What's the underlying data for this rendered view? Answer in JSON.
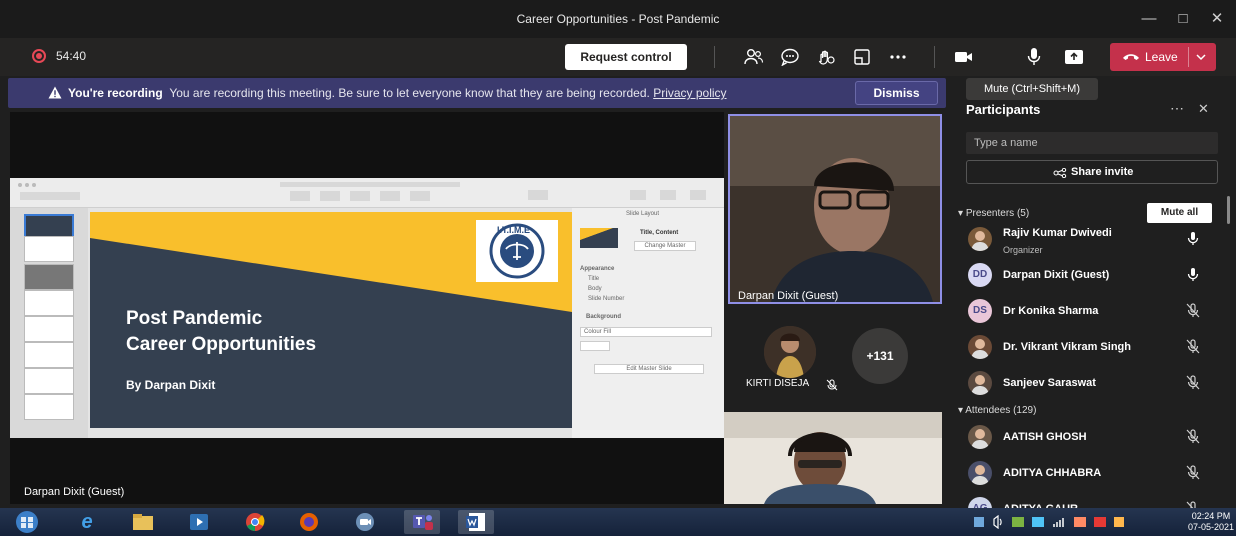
{
  "window": {
    "title": "Career Opportunities - Post Pandemic"
  },
  "toolbar": {
    "timer": "54:40",
    "request_control": "Request control",
    "leave": "Leave",
    "tooltip": "Mute (Ctrl+Shift+M)"
  },
  "banner": {
    "bold": "You're recording",
    "text": "You are recording this meeting. Be sure to let everyone know that they are being recorded.",
    "link": "Privacy policy",
    "dismiss": "Dismiss"
  },
  "shared_screen": {
    "presenter_label": "Darpan Dixit (Guest)",
    "slide_title_1": "Post Pandemic",
    "slide_title_2": "Career Opportunities",
    "slide_byline": "By Darpan Dixit",
    "logo_text": "I.T.I.M.E",
    "inspector": {
      "title": "Slide Layout",
      "layout_name": "Title, Content",
      "change_master": "Change Master",
      "appearance": "Appearance",
      "title_opt": "Title",
      "body_opt": "Body",
      "slide_number_opt": "Slide Number",
      "background": "Background",
      "colour_fill": "Colour Fill",
      "edit_master": "Edit Master Slide"
    }
  },
  "videos": {
    "main_label": "Darpan Dixit (Guest)",
    "kirti_label": "KIRTI DISEJA",
    "overflow_count": "+131"
  },
  "panel": {
    "title": "Participants",
    "search_placeholder": "Type a name",
    "share_invite": "Share invite",
    "presenters_header": "Presenters (5)",
    "mute_all": "Mute all",
    "attendees_header": "Attendees (129)",
    "presenters": [
      {
        "name": "Rajiv Kumar Dwivedi",
        "sub": "Organizer",
        "initials": "",
        "avatar_color": "#7a5a3a"
      },
      {
        "name": "Darpan Dixit (Guest)",
        "sub": "",
        "initials": "DD",
        "avatar_color": "#d9d9f3"
      },
      {
        "name": "Dr Konika Sharma",
        "sub": "",
        "initials": "DS",
        "avatar_color": "#e9c6d8"
      },
      {
        "name": "Dr. Vikrant Vikram Singh",
        "sub": "",
        "initials": "",
        "avatar_color": "#6b4a36"
      },
      {
        "name": "Sanjeev Saraswat",
        "sub": "",
        "initials": "",
        "avatar_color": "#5b4a40"
      }
    ],
    "attendees": [
      {
        "name": "AATISH GHOSH",
        "initials": "",
        "avatar_color": "#6a5848"
      },
      {
        "name": "ADITYA CHHABRA",
        "initials": "",
        "avatar_color": "#4a4f6a"
      },
      {
        "name": "ADITYA GAUR",
        "initials": "AG",
        "avatar_color": "#cfd6ea"
      }
    ]
  },
  "taskbar": {
    "time": "02:24 PM",
    "date": "07-05-2021"
  },
  "colors": {
    "accent": "#6264a7",
    "leave_red": "#c4314b",
    "slide_yellow": "#f9bf2c",
    "slide_navy": "#344050"
  }
}
